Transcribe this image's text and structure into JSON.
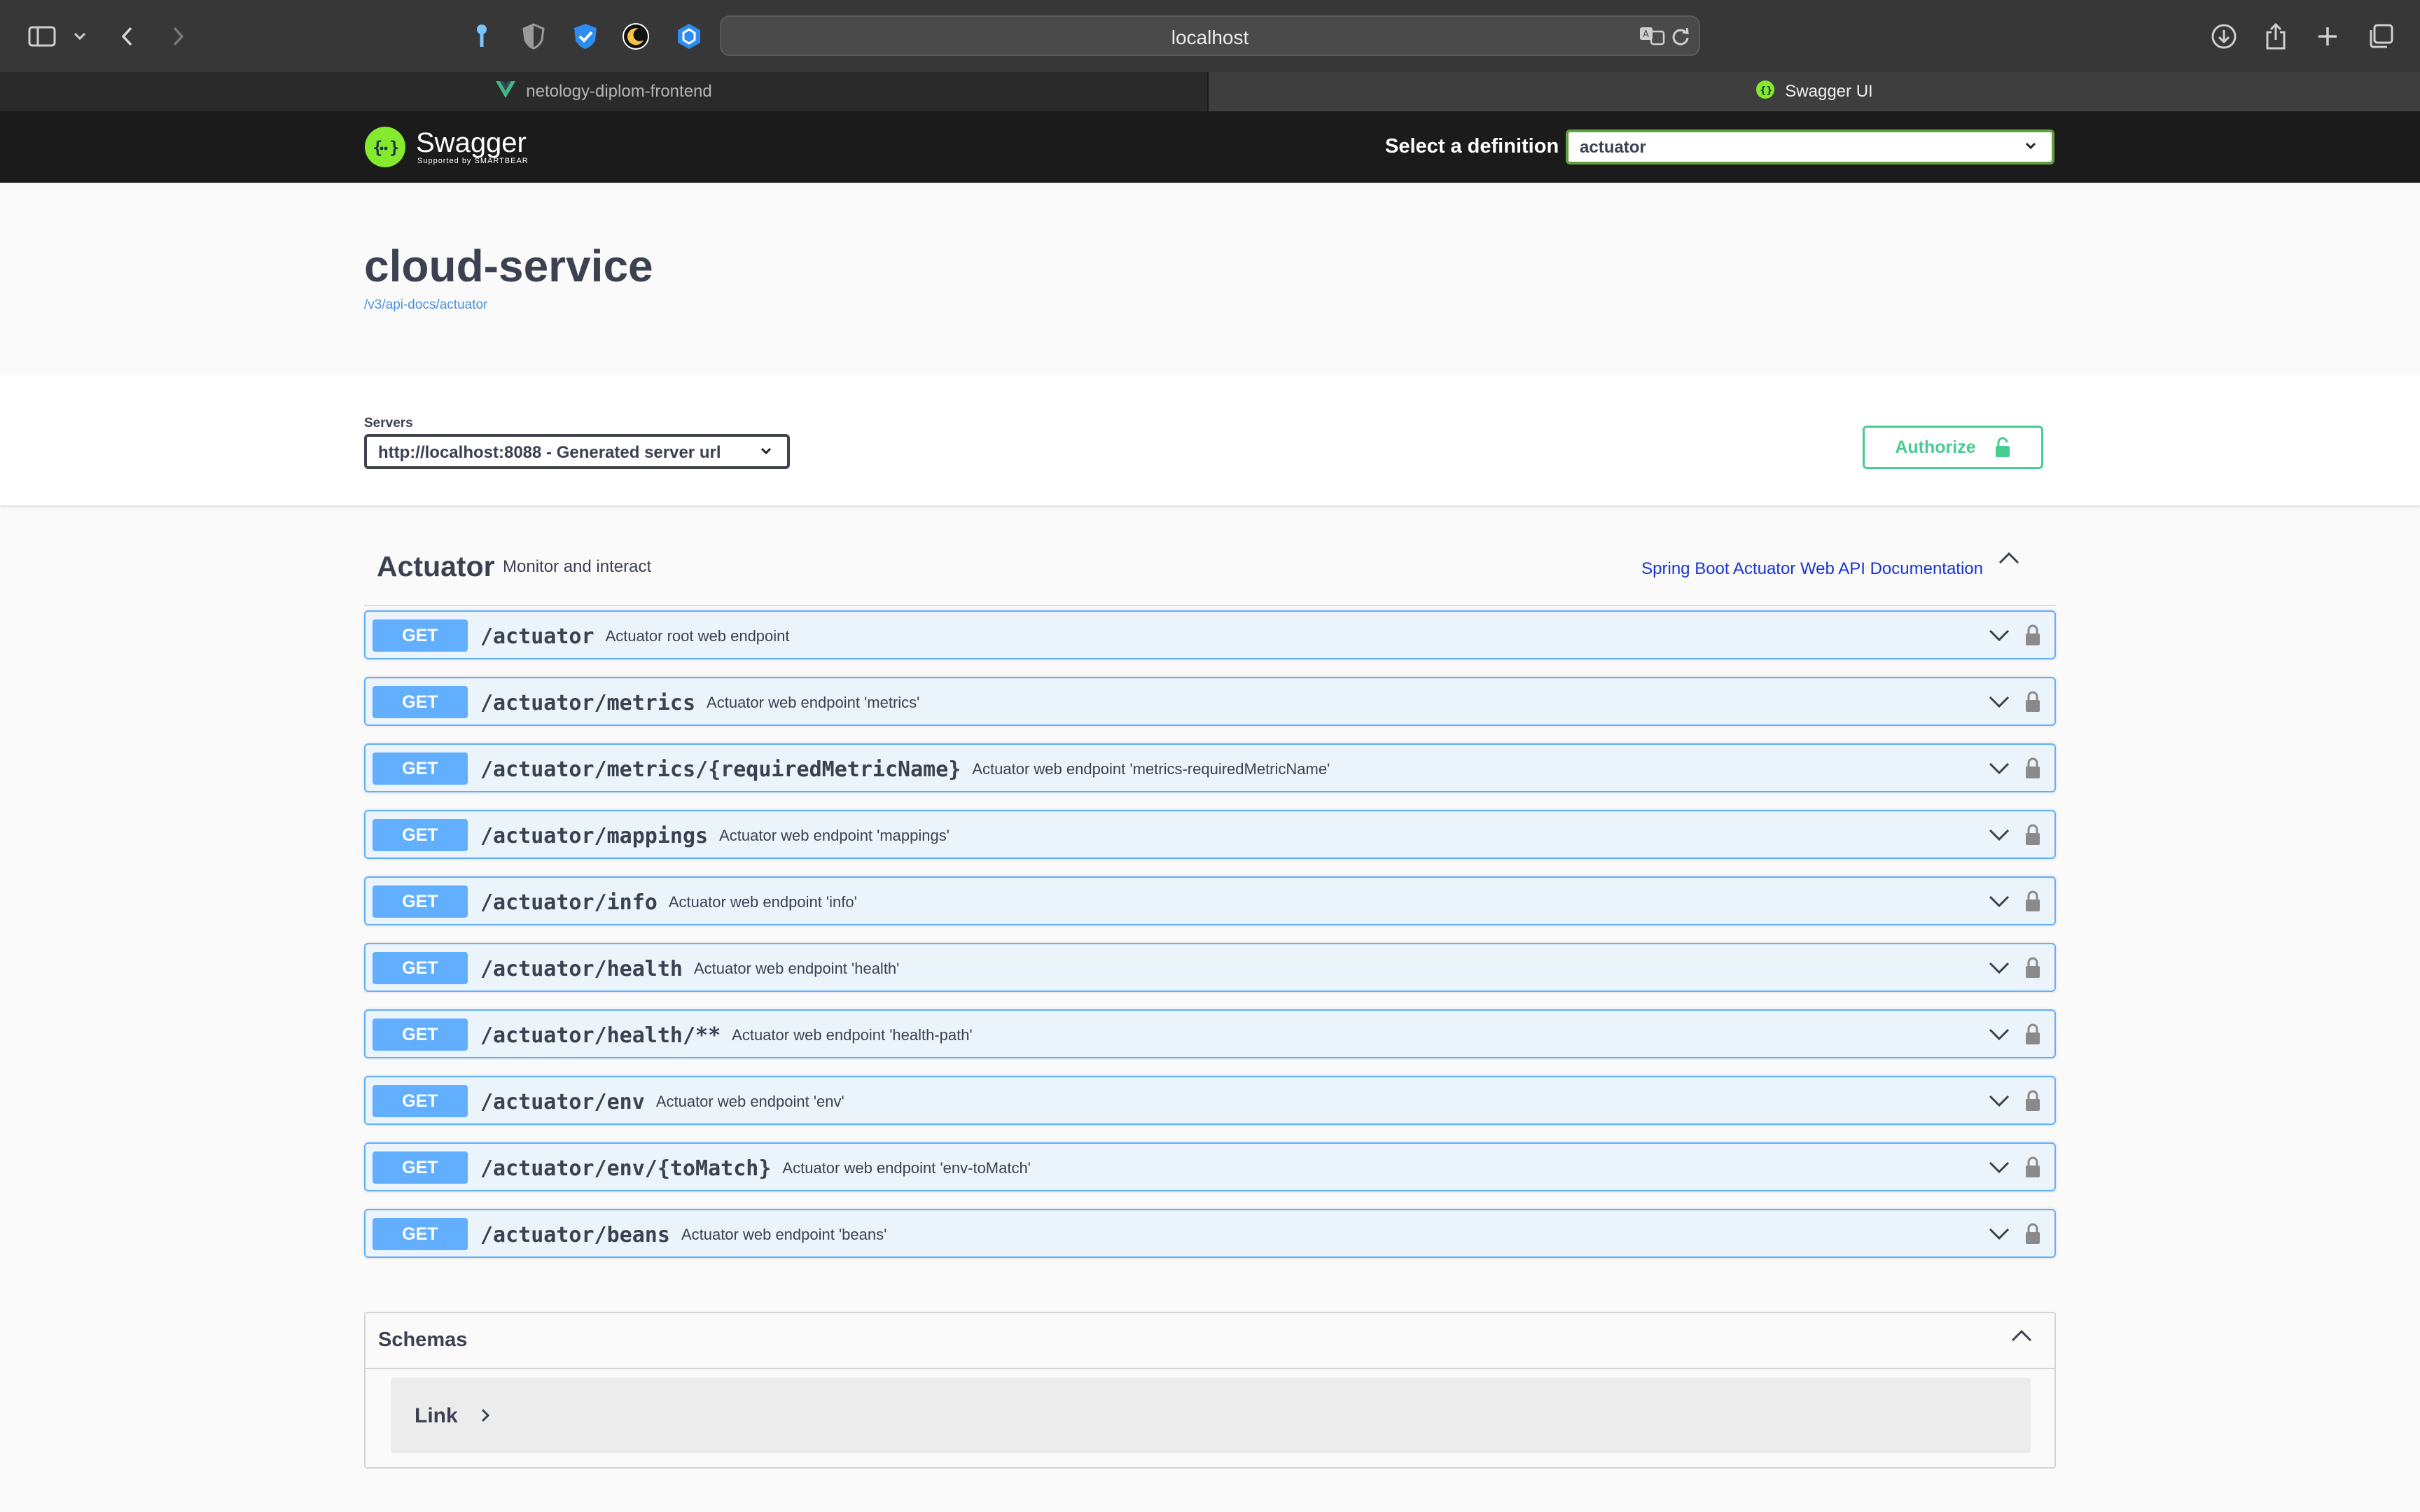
{
  "browser": {
    "url": "localhost",
    "tabs": [
      {
        "label": "netology-diplom-frontend",
        "active": false
      },
      {
        "label": "Swagger UI",
        "active": true
      }
    ]
  },
  "topbar": {
    "logo_text": "Swagger",
    "logo_sub": "Supported by SMARTBEAR",
    "definition_label": "Select a definition",
    "definition_value": "actuator"
  },
  "info": {
    "title": "cloud-service",
    "spec_url": "/v3/api-docs/actuator"
  },
  "servers": {
    "label": "Servers",
    "selected": "http://localhost:8088 - Generated server url",
    "authorize_label": "Authorize"
  },
  "tag": {
    "name": "Actuator",
    "description": "Monitor and interact",
    "doc_link": "Spring Boot Actuator Web API Documentation"
  },
  "operations": [
    {
      "method": "GET",
      "path": "/actuator",
      "summary": "Actuator root web endpoint"
    },
    {
      "method": "GET",
      "path": "/actuator/metrics",
      "summary": "Actuator web endpoint 'metrics'"
    },
    {
      "method": "GET",
      "path": "/actuator/metrics/{requiredMetricName}",
      "summary": "Actuator web endpoint 'metrics-requiredMetricName'"
    },
    {
      "method": "GET",
      "path": "/actuator/mappings",
      "summary": "Actuator web endpoint 'mappings'"
    },
    {
      "method": "GET",
      "path": "/actuator/info",
      "summary": "Actuator web endpoint 'info'"
    },
    {
      "method": "GET",
      "path": "/actuator/health",
      "summary": "Actuator web endpoint 'health'"
    },
    {
      "method": "GET",
      "path": "/actuator/health/**",
      "summary": "Actuator web endpoint 'health-path'"
    },
    {
      "method": "GET",
      "path": "/actuator/env",
      "summary": "Actuator web endpoint 'env'"
    },
    {
      "method": "GET",
      "path": "/actuator/env/{toMatch}",
      "summary": "Actuator web endpoint 'env-toMatch'"
    },
    {
      "method": "GET",
      "path": "/actuator/beans",
      "summary": "Actuator web endpoint 'beans'"
    }
  ],
  "schemas": {
    "title": "Schemas",
    "models": [
      "Link"
    ]
  },
  "colors": {
    "get_method": "#61affe",
    "get_bg": "#ebf3fb",
    "authorize": "#49cc90",
    "swagger_green": "#85ea2d",
    "topbar": "#1b1b1b"
  }
}
